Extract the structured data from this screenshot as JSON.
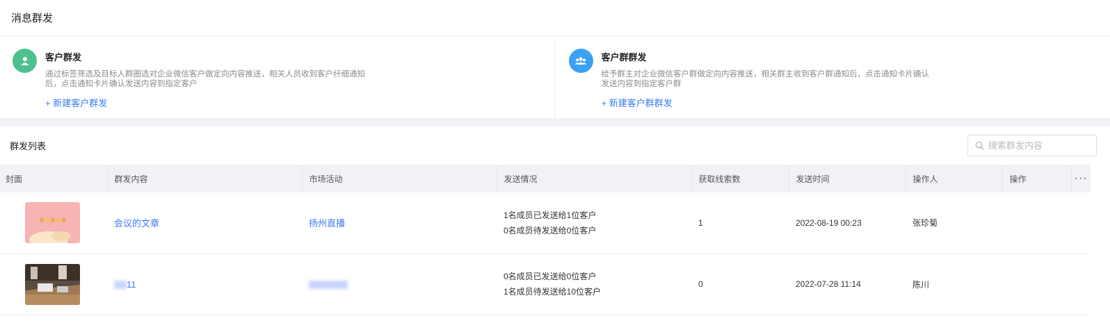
{
  "page": {
    "title": "消息群发"
  },
  "cards": [
    {
      "icon": "user-icon",
      "title": "客户群发",
      "desc": "通过标签筛选及目标人群圈选对企业微信客户做定向内容推送，相关人员收到客户纤细通知后，点击通知卡片确认发送内容到指定客户",
      "link": "+ 新建客户群发"
    },
    {
      "icon": "group-icon",
      "title": "客户群群发",
      "desc": "给予群主对企业微信客户群做定向内容推送，相关群主收到客户群通知后，点击通知卡片确认发送内容到指定客户群",
      "link": "+ 新建客户群群发"
    }
  ],
  "list": {
    "title": "群发列表",
    "search_placeholder": "搜索群发内容",
    "columns": [
      "封面",
      "群发内容",
      "市场活动",
      "发送情况",
      "获取线索数",
      "发送时间",
      "操作人",
      "操作",
      "···"
    ],
    "rows": [
      {
        "content": "会议的文章",
        "activity": "扬州直播",
        "send_line1": "1名成员已发送给1位客户",
        "send_line2": "0名成员待发送给0位客户",
        "leads": "1",
        "time": "2022-08-19 00:23",
        "operator": "张珍菊"
      },
      {
        "content": "11",
        "activity": "",
        "send_line1": "0名成员已发送给0位客户",
        "send_line2": "1名成员待发送给10位客户",
        "leads": "0",
        "time": "2022-07-28 11:14",
        "operator": "陈川"
      }
    ]
  },
  "colors": {
    "accent": "#3a7bf0",
    "green_icon": "#4fc08d",
    "blue_icon": "#3aa1f5"
  }
}
